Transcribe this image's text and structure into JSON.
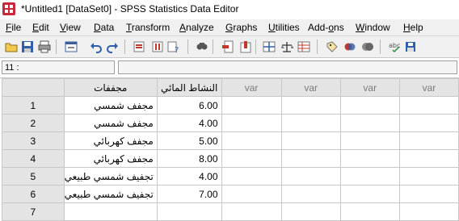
{
  "window": {
    "title": "*Untitled1 [DataSet0] - SPSS Statistics Data Editor"
  },
  "menu": [
    {
      "label": "File",
      "key": "F",
      "rest": "ile"
    },
    {
      "label": "Edit",
      "key": "E",
      "rest": "dit"
    },
    {
      "label": "View",
      "key": "V",
      "rest": "iew"
    },
    {
      "label": "Data",
      "key": "D",
      "rest": "ata"
    },
    {
      "label": "Transform",
      "key": "T",
      "rest": "ransform"
    },
    {
      "label": "Analyze",
      "key": "A",
      "rest": "nalyze"
    },
    {
      "label": "Graphs",
      "key": "G",
      "rest": "raphs"
    },
    {
      "label": "Utilities",
      "key": "U",
      "rest": "tilities"
    },
    {
      "label": "Add-ons",
      "pre": "Add-",
      "key": "o",
      "rest": "ns"
    },
    {
      "label": "Window",
      "key": "W",
      "rest": "indow"
    },
    {
      "label": "Help",
      "key": "H",
      "rest": "elp"
    }
  ],
  "toolbar": {
    "icons": [
      "open-folder-icon",
      "save-icon",
      "print-icon",
      "dialog-recall-icon",
      "undo-icon",
      "redo-icon",
      "goto-case-icon",
      "goto-variable-icon",
      "variables-icon",
      "find-icon",
      "insert-cases-icon",
      "insert-variable-icon",
      "split-file-icon",
      "weight-cases-icon",
      "select-cases-icon",
      "value-labels-icon",
      "use-sets-icon",
      "show-all-variables-icon",
      "spell-check-icon",
      "customize-icon"
    ]
  },
  "cell_editor": {
    "reference": "11 :",
    "value": ""
  },
  "grid": {
    "columns": [
      "مجففات",
      "النشاط المائي",
      "var",
      "var",
      "var",
      "var"
    ],
    "rows": [
      {
        "num": "1",
        "dryer": "مجفف شمسي",
        "value": "6.00"
      },
      {
        "num": "2",
        "dryer": "مجفف شمسي",
        "value": "4.00"
      },
      {
        "num": "3",
        "dryer": "مجفف كهربائي",
        "value": "5.00"
      },
      {
        "num": "4",
        "dryer": "مجفف كهربائي",
        "value": "8.00"
      },
      {
        "num": "5",
        "dryer": "تجفيف شمسي طبيعي",
        "value": "4.00"
      },
      {
        "num": "6",
        "dryer": "تجفيف شمسي طبيعي",
        "value": "7.00"
      },
      {
        "num": "7",
        "dryer": "",
        "value": ""
      }
    ]
  },
  "colors": {
    "app_icon": "#c9283a",
    "header_bg": "#e4e4e4",
    "grid_line": "#c8c8c8"
  }
}
